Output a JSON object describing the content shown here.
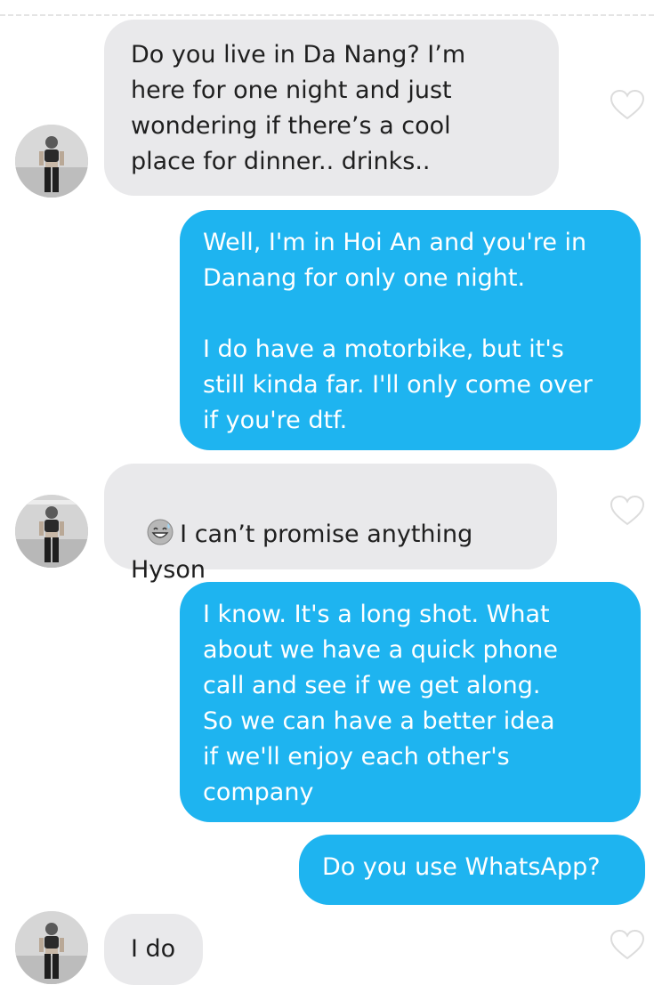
{
  "conversation": {
    "messages": [
      {
        "from": "them",
        "text": "Do you live in Da Nang? I’m\nhere for one night and just\nwondering if there’s a cool\nplace for dinner.. drinks.."
      },
      {
        "from": "me",
        "text": "Well, I'm in Hoi An and you're in\nDanang for only one night.\n\nI do have a motorbike, but it's\nstill kinda far. I'll only come over\nif you're dtf."
      },
      {
        "from": "them",
        "emoji": "grinning-sweat-emoji",
        "text": "I can’t promise anything\nHyson"
      },
      {
        "from": "me",
        "text": "I know. It's a long shot. What\nabout we have a quick phone\ncall and see if we get along.\nSo we can have a better idea\nif we'll enjoy each other's\ncompany"
      },
      {
        "from": "me",
        "text": "Do you use WhatsApp?"
      },
      {
        "from": "them",
        "text": "I do"
      }
    ]
  },
  "colors": {
    "sent_bubble": "#1eb4f0",
    "received_bubble": "#e9e9eb"
  },
  "icons": {
    "like": "heart-outline-icon",
    "avatar": "profile-photo"
  }
}
